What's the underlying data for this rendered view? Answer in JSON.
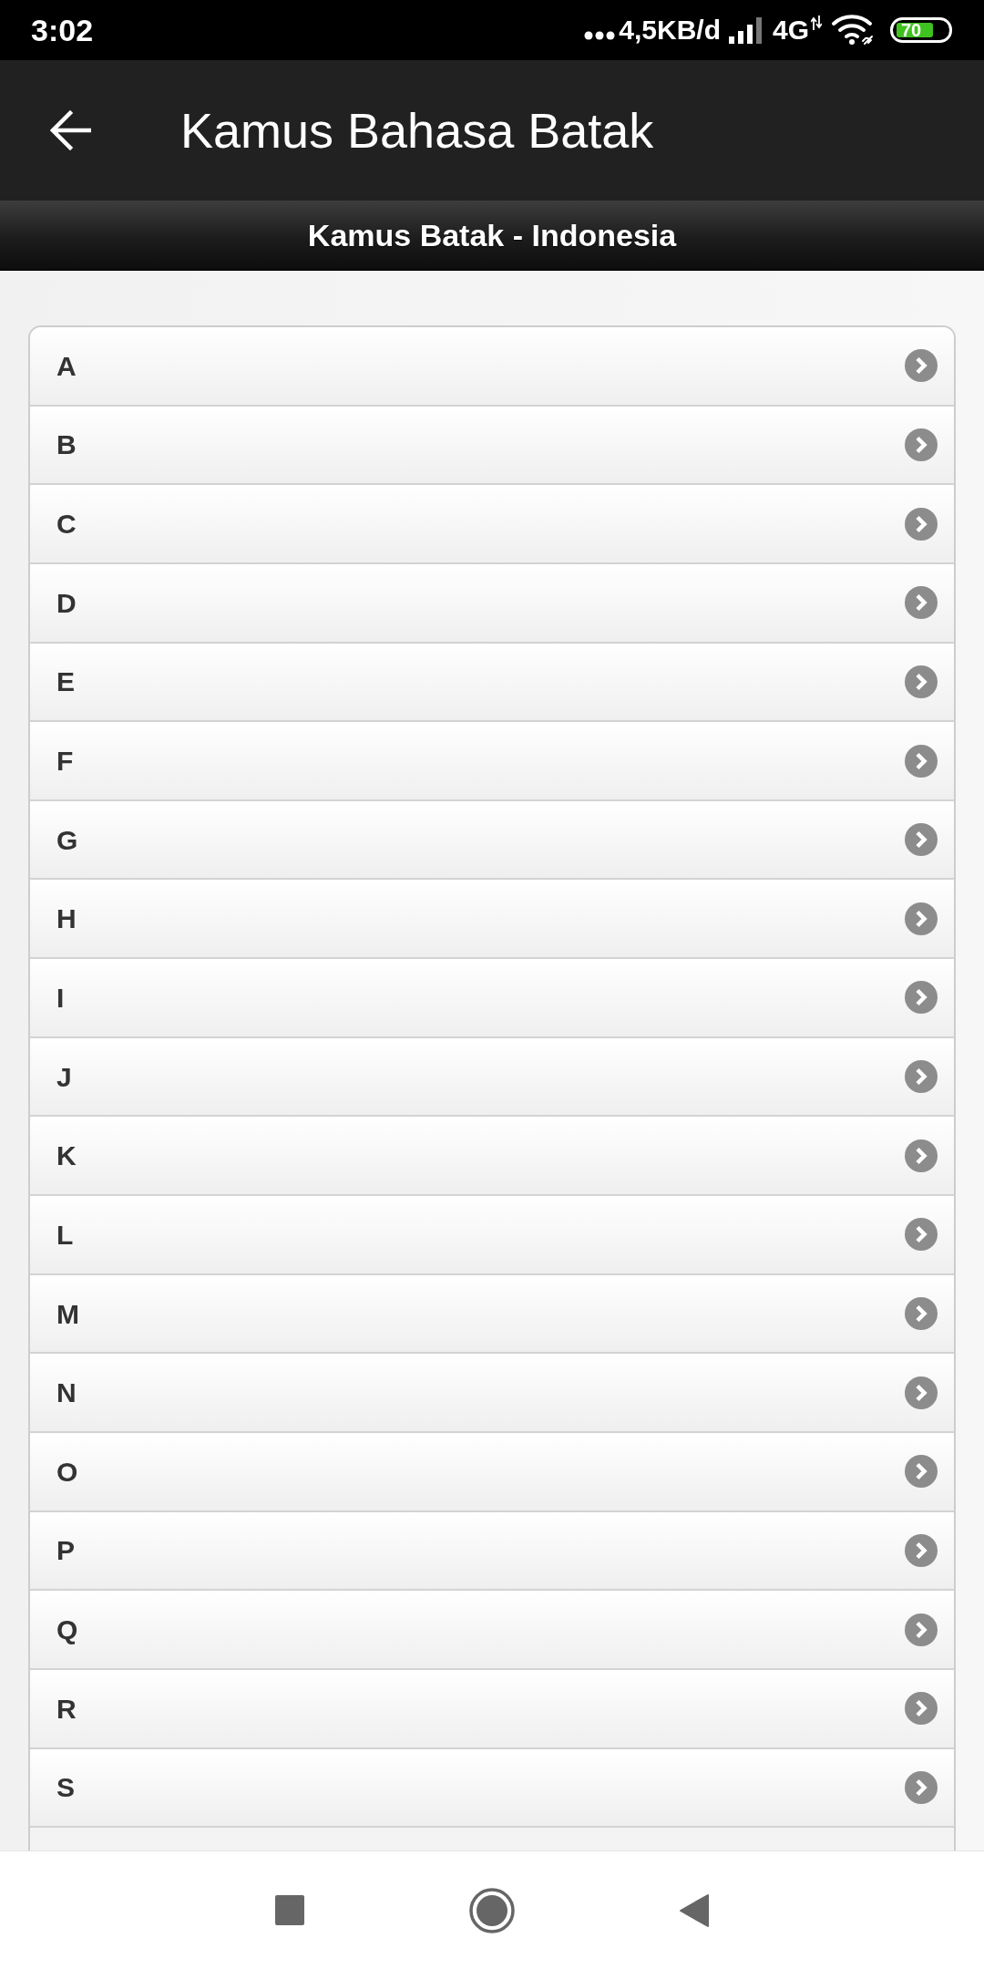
{
  "status_bar": {
    "time": "3:02",
    "network_speed": "4,5KB/d",
    "network_type": "4G",
    "battery": "70"
  },
  "app_bar": {
    "title": "Kamus Bahasa Batak"
  },
  "subheader": {
    "title": "Kamus Batak - Indonesia"
  },
  "letters": [
    {
      "label": "A"
    },
    {
      "label": "B"
    },
    {
      "label": "C"
    },
    {
      "label": "D"
    },
    {
      "label": "E"
    },
    {
      "label": "F"
    },
    {
      "label": "G"
    },
    {
      "label": "H"
    },
    {
      "label": "I"
    },
    {
      "label": "J"
    },
    {
      "label": "K"
    },
    {
      "label": "L"
    },
    {
      "label": "M"
    },
    {
      "label": "N"
    },
    {
      "label": "O"
    },
    {
      "label": "P"
    },
    {
      "label": "Q"
    },
    {
      "label": "R"
    },
    {
      "label": "S"
    }
  ]
}
